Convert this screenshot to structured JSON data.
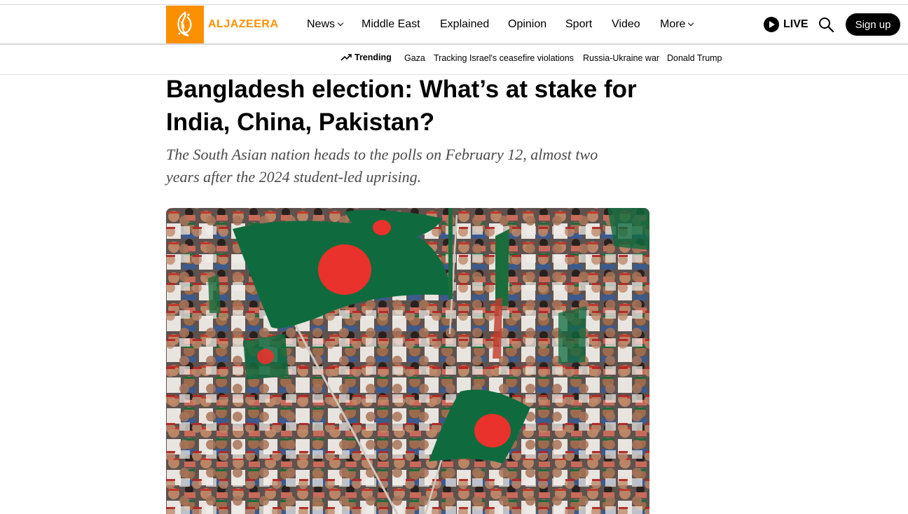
{
  "brand": {
    "name": "ALJAZEERA",
    "color": "#fa9000"
  },
  "nav": {
    "items": [
      {
        "label": "News",
        "has_dropdown": true
      },
      {
        "label": "Middle East",
        "has_dropdown": false
      },
      {
        "label": "Explained",
        "has_dropdown": false
      },
      {
        "label": "Opinion",
        "has_dropdown": false
      },
      {
        "label": "Sport",
        "has_dropdown": false
      },
      {
        "label": "Video",
        "has_dropdown": false
      },
      {
        "label": "More",
        "has_dropdown": true
      }
    ],
    "live_label": "LIVE",
    "signup_label": "Sign up"
  },
  "trending": {
    "label": "Trending",
    "items": [
      "Gaza",
      "Tracking Israel's ceasefire violations",
      "Russia-Ukraine war",
      "Donald Trump"
    ]
  },
  "article": {
    "headline_line1": "Bangladesh election: What’s at stake for",
    "headline_line2": "India, China, Pakistan?",
    "subtitle_line1": "The South Asian nation heads to the polls on February 12, almost two",
    "subtitle_line2": "years after the 2024 student-led uprising."
  },
  "colors": {
    "flag_green": "#0f6b3e",
    "flag_red": "#e8322b",
    "button_bg": "#000000"
  }
}
